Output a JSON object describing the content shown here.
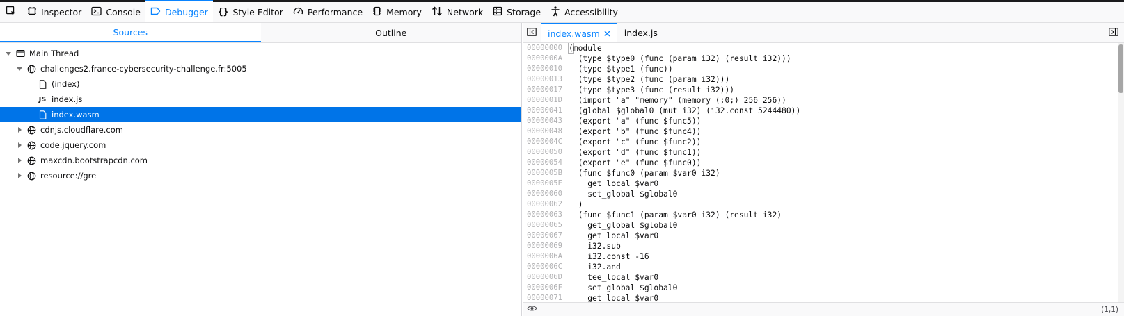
{
  "toolbar": {
    "tabs": [
      {
        "label": "Inspector",
        "icon": "inspector-icon"
      },
      {
        "label": "Console",
        "icon": "console-icon"
      },
      {
        "label": "Debugger",
        "icon": "debugger-icon",
        "active": true
      },
      {
        "label": "Style Editor",
        "icon": "style-editor-icon"
      },
      {
        "label": "Performance",
        "icon": "performance-icon"
      },
      {
        "label": "Memory",
        "icon": "memory-icon"
      },
      {
        "label": "Network",
        "icon": "network-icon"
      },
      {
        "label": "Storage",
        "icon": "storage-icon"
      },
      {
        "label": "Accessibility",
        "icon": "accessibility-icon"
      }
    ],
    "accent_color": "#0a84ff"
  },
  "left_panel": {
    "tabs": [
      {
        "label": "Sources",
        "active": true
      },
      {
        "label": "Outline",
        "active": false
      }
    ],
    "tree": [
      {
        "label": "Main Thread",
        "icon": "thread-icon",
        "expanded": true
      },
      {
        "label": "challenges2.france-cybersecurity-challenge.fr:5005",
        "icon": "globe-icon",
        "expanded": true
      },
      {
        "label": "(index)",
        "icon": "file-icon"
      },
      {
        "label": "index.js",
        "icon": "js-icon"
      },
      {
        "label": "index.wasm",
        "icon": "file-icon",
        "selected": true
      },
      {
        "label": "cdnjs.cloudflare.com",
        "icon": "globe-icon",
        "expanded": false
      },
      {
        "label": "code.jquery.com",
        "icon": "globe-icon",
        "expanded": false
      },
      {
        "label": "maxcdn.bootstrapcdn.com",
        "icon": "globe-icon",
        "expanded": false
      },
      {
        "label": "resource://gre",
        "icon": "globe-icon",
        "expanded": false
      }
    ],
    "selection_color": "#0074e8"
  },
  "editor": {
    "tabs": [
      {
        "label": "index.wasm",
        "active": true,
        "closable": true
      },
      {
        "label": "index.js",
        "active": false
      }
    ],
    "lines": [
      {
        "addr": "00000000",
        "code": "(module"
      },
      {
        "addr": "0000000A",
        "code": "  (type $type0 (func (param i32) (result i32)))"
      },
      {
        "addr": "00000010",
        "code": "  (type $type1 (func))"
      },
      {
        "addr": "00000013",
        "code": "  (type $type2 (func (param i32)))"
      },
      {
        "addr": "00000017",
        "code": "  (type $type3 (func (result i32)))"
      },
      {
        "addr": "0000001D",
        "code": "  (import \"a\" \"memory\" (memory (;0;) 256 256))"
      },
      {
        "addr": "00000041",
        "code": "  (global $global0 (mut i32) (i32.const 5244480))"
      },
      {
        "addr": "00000043",
        "code": "  (export \"a\" (func $func5))"
      },
      {
        "addr": "00000048",
        "code": "  (export \"b\" (func $func4))"
      },
      {
        "addr": "0000004C",
        "code": "  (export \"c\" (func $func2))"
      },
      {
        "addr": "00000050",
        "code": "  (export \"d\" (func $func1))"
      },
      {
        "addr": "00000054",
        "code": "  (export \"e\" (func $func0))"
      },
      {
        "addr": "0000005B",
        "code": "  (func $func0 (param $var0 i32)"
      },
      {
        "addr": "0000005E",
        "code": "    get_local $var0"
      },
      {
        "addr": "00000060",
        "code": "    set_global $global0"
      },
      {
        "addr": "00000062",
        "code": "  )"
      },
      {
        "addr": "00000063",
        "code": "  (func $func1 (param $var0 i32) (result i32)"
      },
      {
        "addr": "00000065",
        "code": "    get_global $global0"
      },
      {
        "addr": "00000067",
        "code": "    get_local $var0"
      },
      {
        "addr": "00000069",
        "code": "    i32.sub"
      },
      {
        "addr": "0000006A",
        "code": "    i32.const -16"
      },
      {
        "addr": "0000006C",
        "code": "    i32.and"
      },
      {
        "addr": "0000006D",
        "code": "    tee_local $var0"
      },
      {
        "addr": "0000006F",
        "code": "    set_global $global0"
      },
      {
        "addr": "00000071",
        "code": "    get_local $var0"
      }
    ],
    "cursor_position": "(1,1)"
  }
}
